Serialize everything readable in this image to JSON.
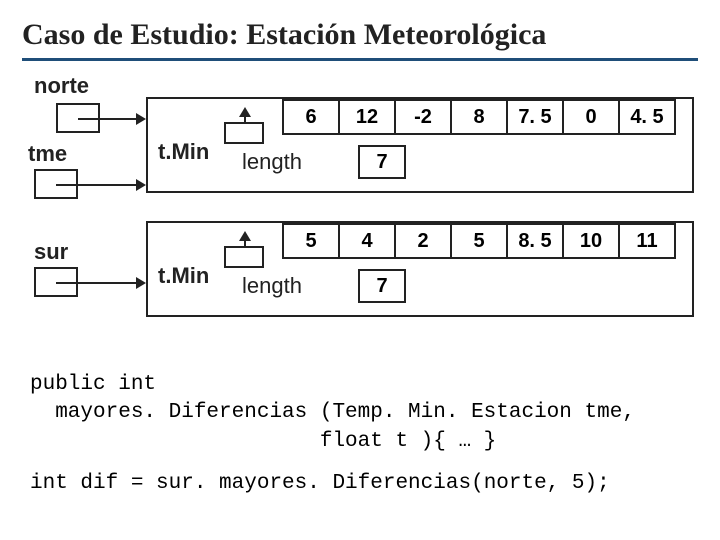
{
  "title": "Caso de Estudio: Estación Meteorológica",
  "labels": {
    "norte": "norte",
    "tme": "tme",
    "sur": "sur",
    "tmin": "t.Min",
    "length": "length"
  },
  "arrays": {
    "norte": {
      "values": [
        "6",
        "12",
        "-2",
        "8",
        "7. 5",
        "0",
        "4. 5"
      ],
      "length": "7"
    },
    "sur": {
      "values": [
        "5",
        "4",
        "2",
        "5",
        "8. 5",
        "10",
        "11"
      ],
      "length": "7"
    }
  },
  "code": {
    "line1a": "public int",
    "line1b": "  mayores. Diferencias (Temp. Min. Estacion ",
    "line1c": "tme",
    "line1d": ",",
    "line2": "                       float t ){ … }",
    "line3a": "int dif = sur. mayores. Diferencias(",
    "line3b": "norte",
    "line3c": ", 5);"
  }
}
